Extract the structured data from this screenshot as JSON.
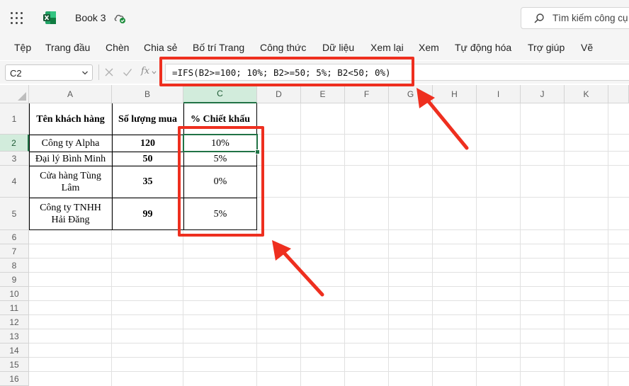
{
  "app": {
    "title": "Book 3",
    "search_placeholder": "Tìm kiếm công cụ"
  },
  "menu": [
    "Tệp",
    "Trang đầu",
    "Chèn",
    "Chia sẻ",
    "Bố trí Trang",
    "Công thức",
    "Dữ liệu",
    "Xem lại",
    "Xem",
    "Tự động hóa",
    "Trợ giúp",
    "Vẽ"
  ],
  "formula_bar": {
    "name_box": "C2",
    "fx_label": "fx",
    "formula": "=IFS(B2>=100; 10%; B2>=50; 5%; B2<50; 0%)"
  },
  "columns": [
    "A",
    "B",
    "C",
    "D",
    "E",
    "F",
    "G",
    "H",
    "I",
    "J",
    "K"
  ],
  "rows": [
    "1",
    "2",
    "3",
    "4",
    "5",
    "6",
    "7",
    "8",
    "9",
    "10",
    "11",
    "12",
    "13",
    "14",
    "15",
    "16"
  ],
  "table": {
    "headers": [
      "Tên khách hàng",
      "Số lượng mua",
      "% Chiết khấu"
    ],
    "rows": [
      {
        "name": "Công ty Alpha",
        "qty": "120",
        "discount": "10%"
      },
      {
        "name": "Đại lý Bình Minh",
        "qty": "50",
        "discount": "5%"
      },
      {
        "name": "Cửa hàng Tùng Lâm",
        "qty": "35",
        "discount": "0%"
      },
      {
        "name": "Công ty TNHH Hải Đăng",
        "qty": "99",
        "discount": "5%"
      }
    ]
  },
  "selection": {
    "active_cell": "C2",
    "active_column": "C",
    "active_row": "2"
  },
  "colors": {
    "excel_green": "#217346",
    "annotation_red": "#ee2f1f",
    "header_selected": "#d2ecdc"
  },
  "icons": [
    "waffle-icon",
    "excel-logo-icon",
    "cloud-saved-icon",
    "search-icon",
    "chevron-down-icon",
    "cancel-icon",
    "enter-icon"
  ]
}
